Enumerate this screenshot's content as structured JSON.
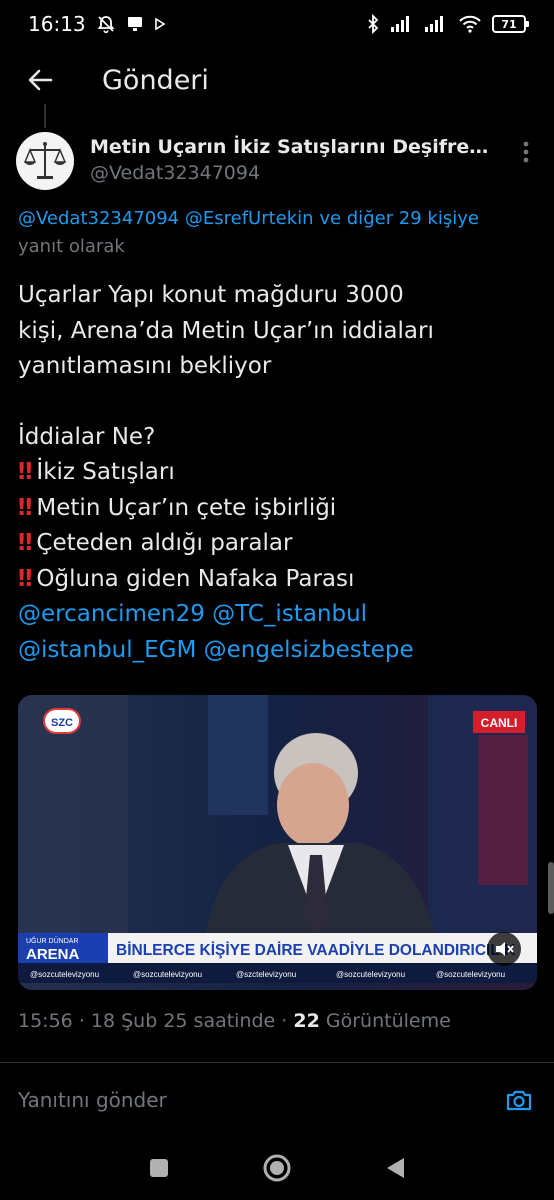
{
  "status_bar": {
    "time": "16:13",
    "battery": "71",
    "icons": [
      "notifications-off-icon",
      "bluetooth-icon",
      "signal-icon",
      "wifi-icon",
      "battery-icon"
    ]
  },
  "header": {
    "title": "Gönderi"
  },
  "author": {
    "name": "Metin Uçarın İkiz Satışlarını Deşifre…",
    "handle": "@Vedat32347094"
  },
  "reply_context": {
    "mention_1": "@Vedat32347094",
    "mention_2": "@EsrefUrtekin",
    "and_others": "ve diğer 29 kişiye",
    "suffix": "yanıt olarak"
  },
  "tweet": {
    "line_1": "Uçarlar Yapı konut mağduru 3000",
    "line_2": "kişi, Arena’da Metin Uçar’ın iddiaları",
    "line_3": "yanıtlamasını bekliyor",
    "question": "İddialar Ne?",
    "bullet_mark": "‼",
    "bullets": [
      "İkiz Satışları",
      "Metin Uçar’ın çete işbirliği",
      "Çeteden aldığı paralar",
      "Oğluna giden Nafaka Parası"
    ],
    "mentions": [
      "@ercancimen29",
      "@TC_istanbul",
      "@istanbul_EGM",
      "@engelsizbestepe"
    ]
  },
  "media": {
    "channel_logo": "SZC",
    "live_badge": "CANLI",
    "show_small": "UĞUR DÜNDAR",
    "show_name": "ARENA",
    "headline": "BİNLERCE KİŞİYE DAİRE VAADİYLE DOLANDIRICILIK",
    "socials": [
      "@sozcutelevizyonu",
      "@sozcutelevizyonu",
      "@szctelevizyonu",
      "@sozcutelevizyonu",
      "@sozcutelevizyonu"
    ]
  },
  "meta": {
    "time": "15:56",
    "date": "18 Şub 25 saatinde",
    "views_count": "22",
    "views_label": "Görüntüleme"
  },
  "reply_bar": {
    "placeholder": "Yanıtını gönder"
  },
  "colors": {
    "accent": "#1d9bf0",
    "background": "#000000",
    "text": "#e7e9ea",
    "muted": "#71767b",
    "alert": "#e0262d"
  }
}
